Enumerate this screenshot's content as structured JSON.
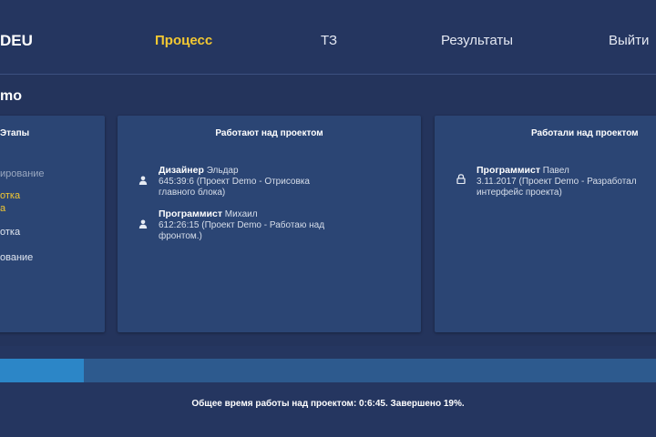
{
  "header": {
    "logo": "DEU",
    "nav": {
      "process": "Процесс",
      "tz": "ТЗ",
      "results": "Результаты",
      "logout": "Выйти"
    }
  },
  "project": {
    "title": "mo"
  },
  "stages": {
    "title": "Этапы",
    "items": [
      "ирование",
      "отка",
      "а",
      "отка",
      "ование"
    ]
  },
  "working": {
    "title": "Работают над проектом",
    "workers": [
      {
        "role": "Дизайнер",
        "name": "Эльдар",
        "line1": "645:39:6 (Проект Demo - Отрисовка",
        "line2": "главного блока)"
      },
      {
        "role": "Программист",
        "name": "Михаил",
        "line1": "612:26:15 (Проект Demo - Работаю над",
        "line2": "фронтом.)"
      }
    ]
  },
  "worked": {
    "title": "Работали над проектом",
    "workers": [
      {
        "role": "Программист",
        "name": "Павел",
        "line1": "3.11.2017 (Проект Demo - Разработал",
        "line2": "интерфейс проекта)"
      }
    ]
  },
  "progress": {
    "completed_fraction": 0.128,
    "summary": "Общее время работы над проектом: 0:6:45. Завершено 19%."
  },
  "colors": {
    "accent": "#f3c832",
    "background": "#24345c",
    "panel": "#2b4574",
    "progress_fill": "#2c86c7",
    "progress_track": "#2d5a8e"
  }
}
